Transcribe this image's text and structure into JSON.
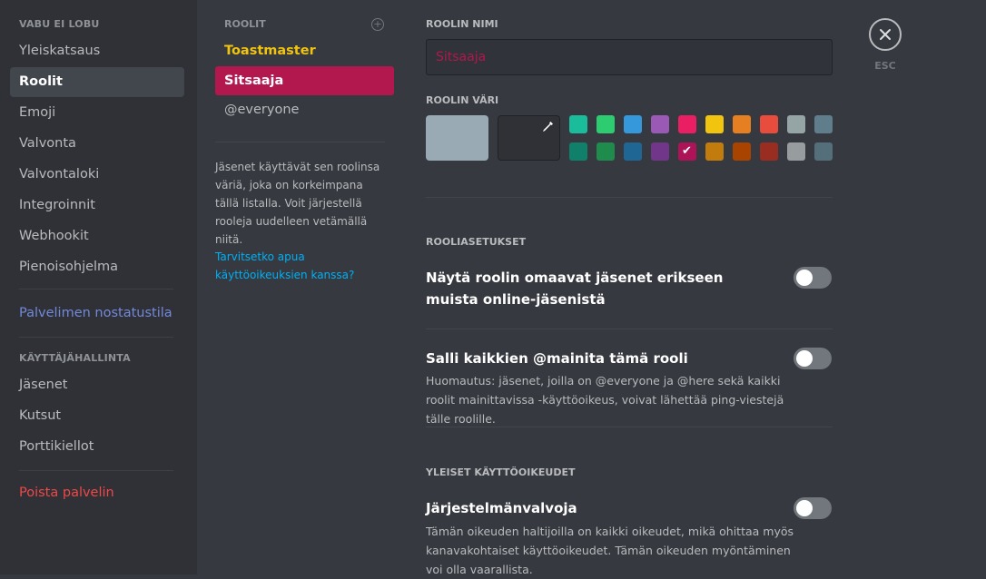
{
  "sidebar": {
    "server_header": "VABU EI LOBU",
    "items": [
      "Yleiskatsaus",
      "Roolit",
      "Emoji",
      "Valvonta",
      "Valvontaloki",
      "Integroinnit",
      "Webhookit",
      "Pienoisohjelma"
    ],
    "boost": "Palvelimen nostatustila",
    "user_header": "KÄYTTÄJÄHALLINTA",
    "user_items": [
      "Jäsenet",
      "Kutsut",
      "Porttikiellot"
    ],
    "delete": "Poista palvelin"
  },
  "roles": {
    "header": "ROOLIT",
    "list": [
      "Toastmaster",
      "Sitsaaja",
      "@everyone"
    ],
    "help_text": "Jäsenet käyttävät sen roolinsa väriä, joka on korkeimpana tällä listalla. Voit järjestellä rooleja uudelleen vetämällä niitä.",
    "help_link": "Tarvitsetko apua käyttöoikeuksien kanssa?"
  },
  "settings": {
    "name_label": "ROOLIN NIMI",
    "name_value": "Sitsaaja",
    "color_label": "ROOLIN VÄRI",
    "colors": {
      "default": "#99aab5",
      "row1": [
        "#1abc9c",
        "#2ecc71",
        "#3498db",
        "#9b59b6",
        "#e91e63",
        "#f1c40f",
        "#e67e22",
        "#e74c3c",
        "#95a5a6",
        "#607d8b"
      ],
      "row2": [
        "#11806a",
        "#1f8b4c",
        "#206694",
        "#71368a",
        "#ad1457",
        "#c27c0e",
        "#a84300",
        "#992d22",
        "#979c9f",
        "#546e7a"
      ],
      "selected": "#ad1457"
    },
    "role_settings_label": "ROOLIASETUKSET",
    "hoist_title": "Näytä roolin omaavat jäsenet erikseen muista online-jäsenistä",
    "mention_title": "Salli kaikkien @mainita tämä rooli",
    "mention_desc": "Huomautus: jäsenet, joilla on @everyone ja @here sekä kaikki roolit mainittavissa -käyttöoikeus, voivat lähettää ping-viestejä tälle roolille.",
    "general_label": "YLEISET KÄYTTÖOIKEUDET",
    "admin_title": "Järjestelmänvalvoja",
    "admin_desc": "Tämän oikeuden haltijoilla on kaikki oikeudet, mikä ohittaa myös kanavakohtaiset käyttöoikeudet. Tämän oikeuden myöntäminen voi olla vaarallista."
  },
  "close": {
    "label": "ESC"
  }
}
